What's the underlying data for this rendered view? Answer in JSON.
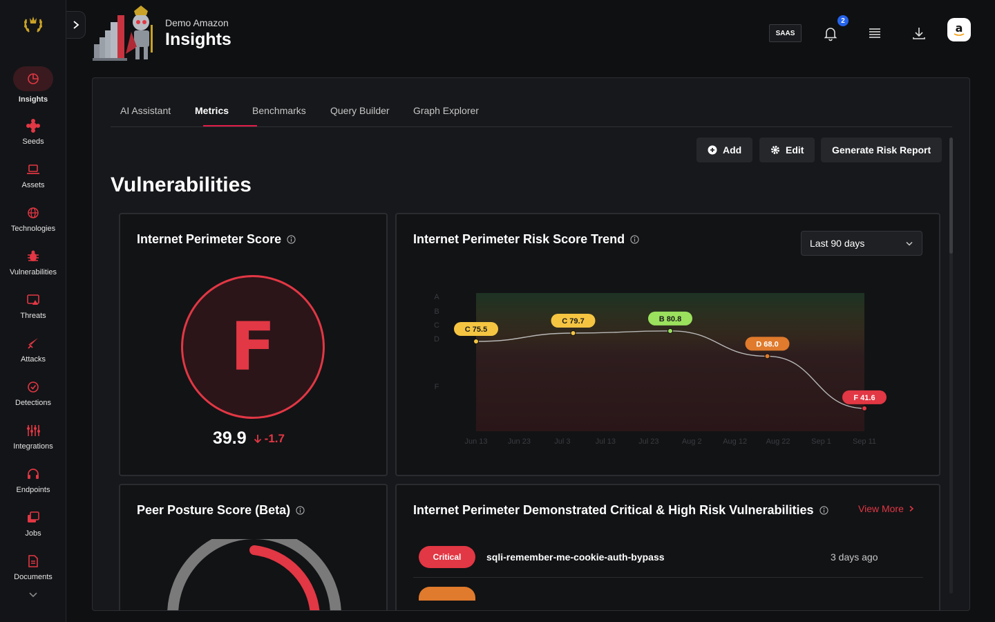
{
  "header": {
    "org": "Demo Amazon",
    "title": "Insights",
    "env_badge": "SAAS",
    "notifications_count": "2",
    "avatar_letter": "a"
  },
  "sidebar": {
    "items": [
      {
        "label": "Insights",
        "icon": "chart-pie-icon",
        "active": true
      },
      {
        "label": "Seeds",
        "icon": "seed-icon"
      },
      {
        "label": "Assets",
        "icon": "laptop-icon"
      },
      {
        "label": "Technologies",
        "icon": "globe-icon"
      },
      {
        "label": "Vulnerabilities",
        "icon": "bug-icon"
      },
      {
        "label": "Threats",
        "icon": "threat-icon"
      },
      {
        "label": "Attacks",
        "icon": "sword-icon"
      },
      {
        "label": "Detections",
        "icon": "check-circle-icon"
      },
      {
        "label": "Integrations",
        "icon": "integrations-icon"
      },
      {
        "label": "Endpoints",
        "icon": "headset-icon"
      },
      {
        "label": "Jobs",
        "icon": "jobs-icon"
      },
      {
        "label": "Documents",
        "icon": "document-icon"
      }
    ]
  },
  "tabs": [
    {
      "label": "AI Assistant"
    },
    {
      "label": "Metrics",
      "active": true
    },
    {
      "label": "Benchmarks"
    },
    {
      "label": "Query Builder"
    },
    {
      "label": "Graph Explorer"
    }
  ],
  "actions": {
    "add": "Add",
    "edit": "Edit",
    "report": "Generate Risk Report"
  },
  "section_title": "Vulnerabilities",
  "score_card": {
    "title": "Internet Perimeter Score",
    "grade": "F",
    "score": "39.9",
    "delta": "-1.7"
  },
  "trend_card": {
    "title": "Internet Perimeter Risk Score Trend",
    "range": "Last 90 days"
  },
  "peer_card": {
    "title": "Peer Posture Score (Beta)"
  },
  "vulns_card": {
    "title": "Internet Perimeter Demonstrated Critical & High Risk Vulnerabilities",
    "view_more": "View More",
    "rows": [
      {
        "severity": "Critical",
        "name": "sqli-remember-me-cookie-auth-bypass",
        "time": "3 days ago"
      }
    ]
  },
  "chart_data": {
    "type": "line",
    "x": [
      "Jun 13",
      "Jul 3",
      "Jul 23",
      "Aug 12",
      "Sep 11"
    ],
    "x_ticks": [
      "Jun 13",
      "Jun 23",
      "Jul 3",
      "Jul 13",
      "Jul 23",
      "Aug 2",
      "Aug 12",
      "Aug 22",
      "Sep 1",
      "Sep 11"
    ],
    "y_bands": [
      "A",
      "B",
      "C",
      "D",
      "F"
    ],
    "series": [
      {
        "values": [
          75.5,
          79.7,
          80.8,
          68.0,
          41.6
        ],
        "labels": [
          "C 75.5",
          "C 79.7",
          "B 80.8",
          "D 68.0",
          "F 41.6"
        ],
        "colors": [
          "#f5c542",
          "#f5c542",
          "#9be15d",
          "#e07a2c",
          "#e23744"
        ]
      }
    ],
    "ylim": [
      30,
      100
    ],
    "grid": false
  }
}
